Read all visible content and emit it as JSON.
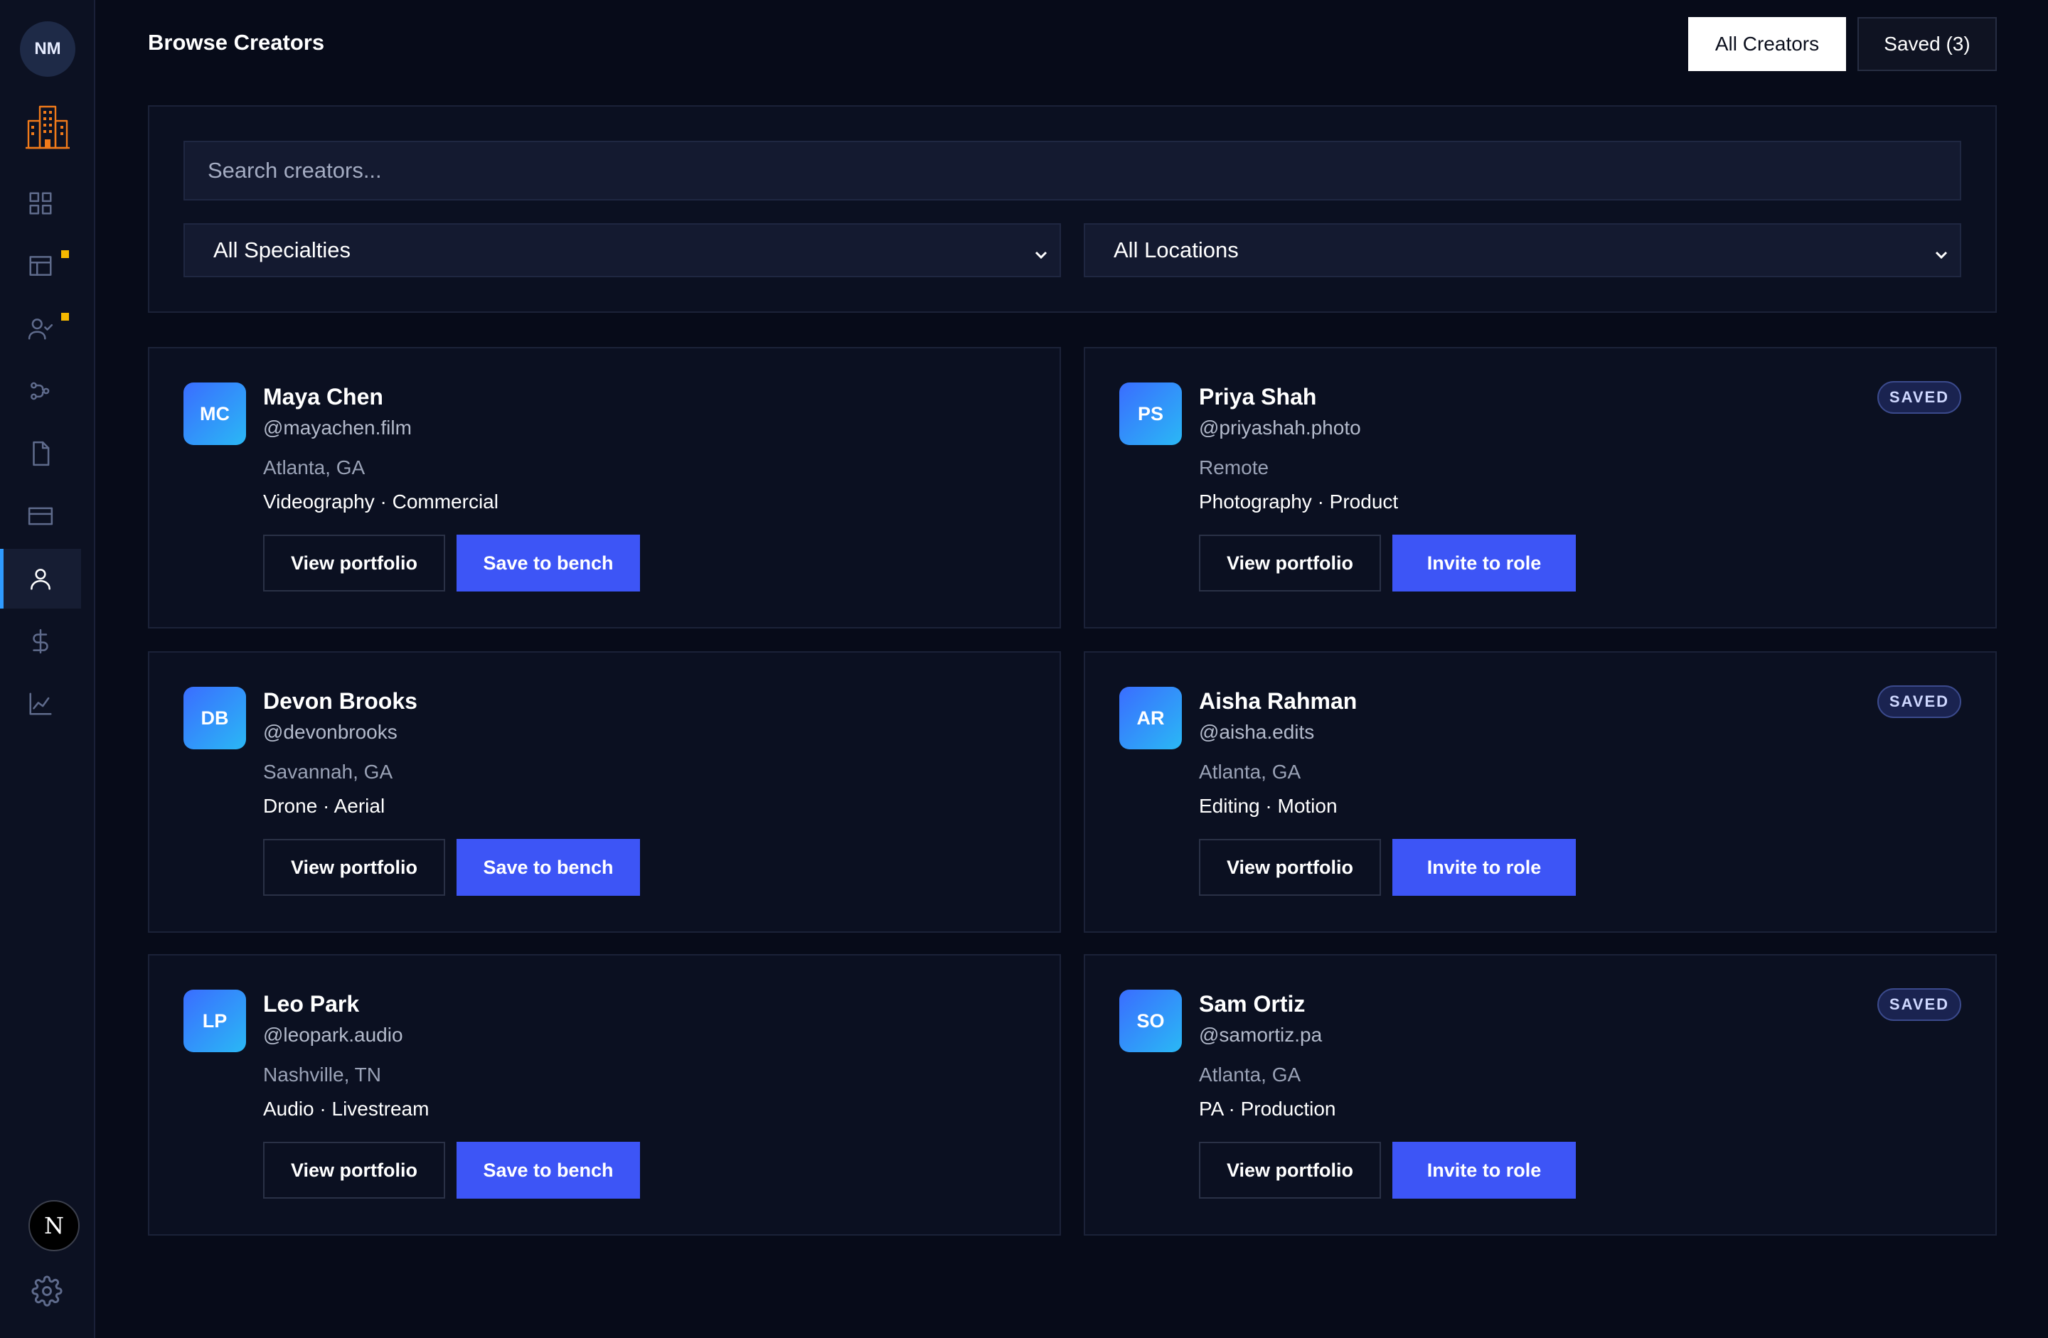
{
  "user": {
    "initials": "NM"
  },
  "header": {
    "title": "Browse Creators"
  },
  "tabs": {
    "all_label": "All Creators",
    "saved_label": "Saved (3)"
  },
  "filters": {
    "search_placeholder": "Search creators...",
    "specialty": "All Specialties",
    "location": "All Locations"
  },
  "nav_icons": [
    "dashboard-icon",
    "projects-icon",
    "applicants-icon",
    "workflow-icon",
    "documents-icon",
    "payments-card-icon",
    "creators-icon",
    "dollar-icon",
    "analytics-icon"
  ],
  "accent_colors": {
    "primary": "#3d55f6",
    "active_indicator": "#2f9bff",
    "notification": "#f5b800"
  },
  "creators": [
    {
      "initials": "MC",
      "name": "Maya Chen",
      "handle": "@mayachen.film",
      "location": "Atlanta, GA",
      "tags": "Videography · Commercial",
      "view": "View portfolio",
      "action": "Save to bench",
      "badge": ""
    },
    {
      "initials": "PS",
      "name": "Priya Shah",
      "handle": "@priyashah.photo",
      "location": "Remote",
      "tags": "Photography · Product",
      "view": "View portfolio",
      "action": "Invite to role",
      "badge": "SAVED"
    },
    {
      "initials": "DB",
      "name": "Devon Brooks",
      "handle": "@devonbrooks",
      "location": "Savannah, GA",
      "tags": "Drone · Aerial",
      "view": "View portfolio",
      "action": "Save to bench",
      "badge": ""
    },
    {
      "initials": "AR",
      "name": "Aisha Rahman",
      "handle": "@aisha.edits",
      "location": "Atlanta, GA",
      "tags": "Editing · Motion",
      "view": "View portfolio",
      "action": "Invite to role",
      "badge": "SAVED"
    },
    {
      "initials": "LP",
      "name": "Leo Park",
      "handle": "@leopark.audio",
      "location": "Nashville, TN",
      "tags": "Audio · Livestream",
      "view": "View portfolio",
      "action": "Save to bench",
      "badge": ""
    },
    {
      "initials": "SO",
      "name": "Sam Ortiz",
      "handle": "@samortiz.pa",
      "location": "Atlanta, GA",
      "tags": "PA · Production",
      "view": "View portfolio",
      "action": "Invite to role",
      "badge": "SAVED"
    }
  ],
  "footer": {
    "framework_badge": "N"
  }
}
